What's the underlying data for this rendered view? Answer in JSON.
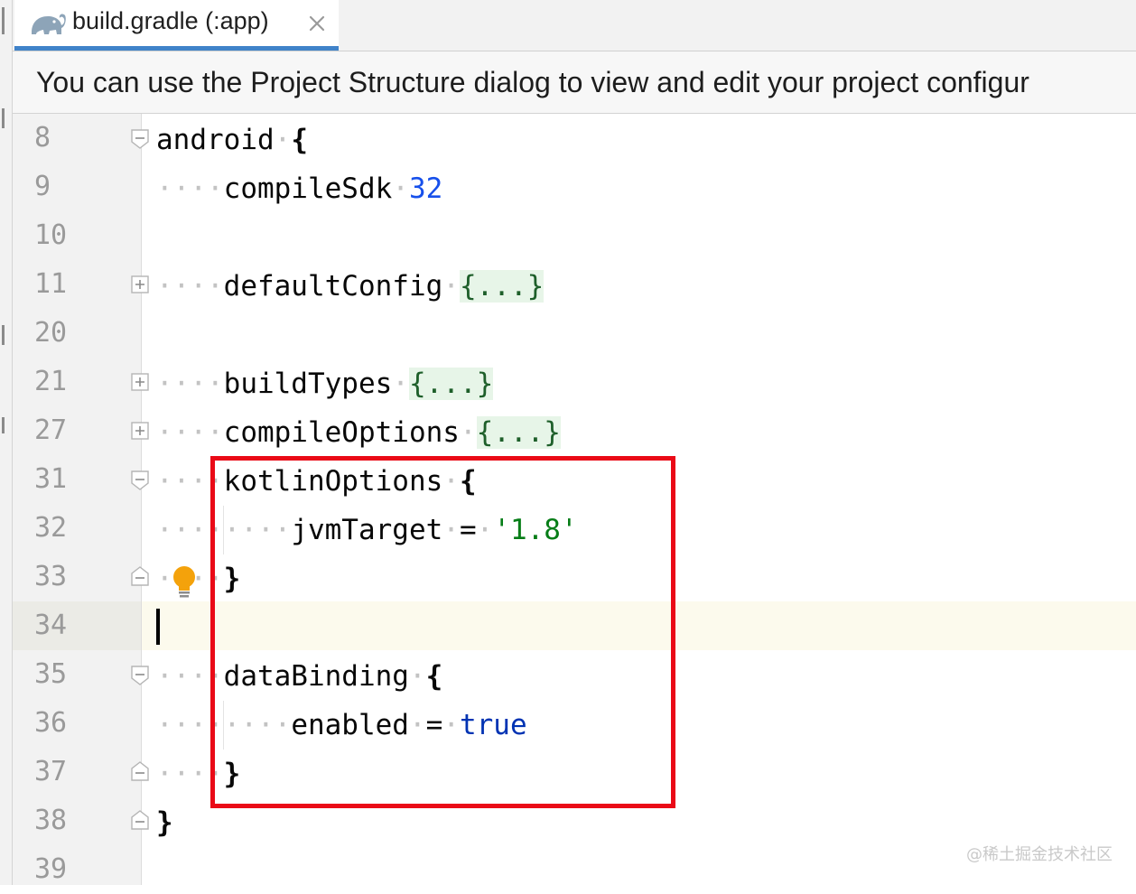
{
  "tab": {
    "title": "build.gradle (:app)",
    "icon": "gradle-elephant-icon",
    "close_icon": "close-icon"
  },
  "banner": {
    "text": "You can use the Project Structure dialog to view and edit your project configur"
  },
  "line_numbers": [
    "8",
    "9",
    "10",
    "11",
    "20",
    "21",
    "27",
    "31",
    "32",
    "33",
    "34",
    "35",
    "36",
    "37",
    "38",
    "39"
  ],
  "code": {
    "l8": {
      "ident": "android",
      "brace": "{"
    },
    "l9": {
      "ident": "compileSdk",
      "value": "32"
    },
    "l11": {
      "ident": "defaultConfig",
      "folded": "{...}"
    },
    "l21": {
      "ident": "buildTypes",
      "folded": "{...}"
    },
    "l27": {
      "ident": "compileOptions",
      "folded": "{...}"
    },
    "l31": {
      "ident": "kotlinOptions",
      "brace": "{"
    },
    "l32": {
      "ident": "jvmTarget",
      "op": "=",
      "value": "'1.8'"
    },
    "l33": {
      "brace": "}"
    },
    "l35": {
      "ident": "dataBinding",
      "brace": "{"
    },
    "l36": {
      "ident": "enabled",
      "op": "=",
      "value": "true"
    },
    "l37": {
      "brace": "}"
    },
    "l38": {
      "brace": "}"
    }
  },
  "colors": {
    "highlight_box": "#ea0a17",
    "tab_accent": "#4083c9",
    "number": "#1750eb",
    "string": "#067d17",
    "keyword": "#0033b3"
  },
  "watermark": "@稀土掘金技术社区"
}
